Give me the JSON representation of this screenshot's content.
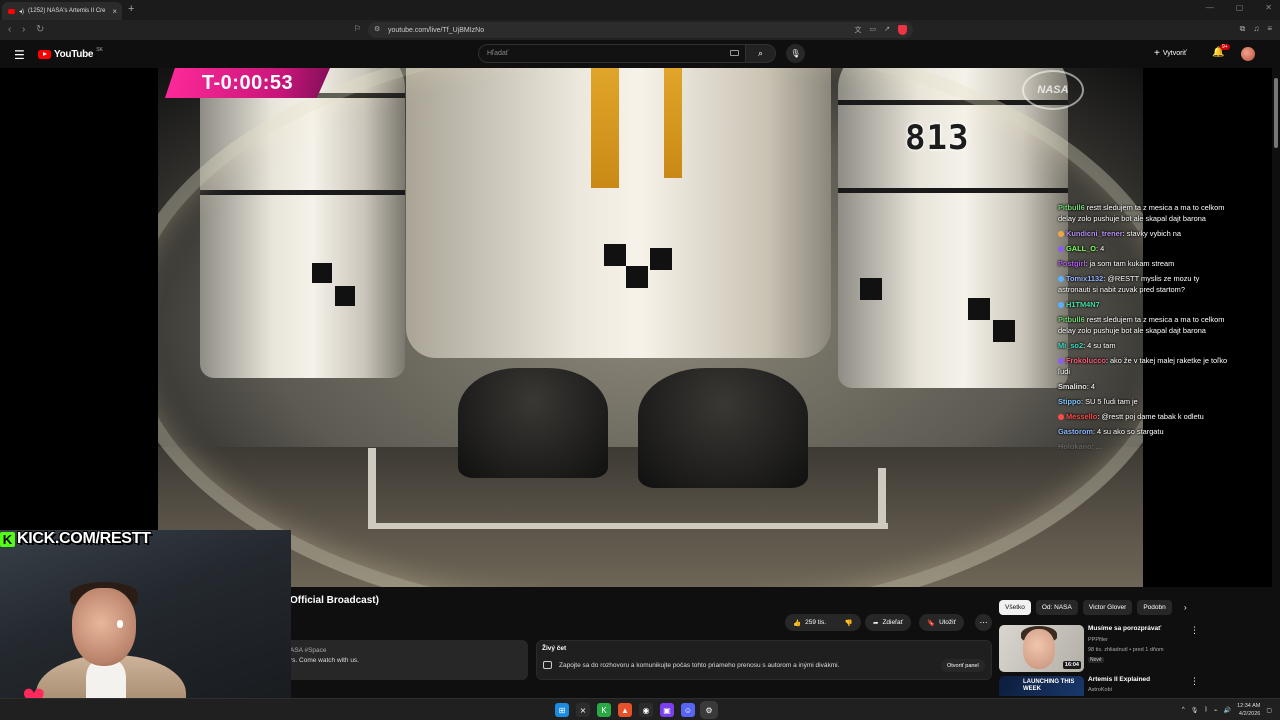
{
  "browser": {
    "tab_title": "(1252) NASA's Artemis II Cre",
    "url": "youtube.com/live/Tf_UjBMIzNo"
  },
  "masthead": {
    "logo_text": "YouTube",
    "country_code": "SK",
    "search_placeholder": "Hľadať",
    "create_label": "Vytvoriť",
    "notif_count": "9+"
  },
  "video": {
    "countdown": "T-0:00:53",
    "digits": "813",
    "logo_text": "NASA",
    "kick_channel": "KICK.COM/RESTT"
  },
  "chat": [
    {
      "name": "Pitbull6",
      "color": "#6fd46f",
      "text": " restt sledujem ta z mesica a ma to celkom delay zolo pushuje bot ale skapal dajt barona"
    },
    {
      "name": "Kundicni_trener",
      "color": "#b38cf0",
      "text": ": stavky vybich na",
      "badge": "#f0a640"
    },
    {
      "name": "GALL_O",
      "color": "#7cff5a",
      "text": ": 4",
      "badge": "#8a5cf5"
    },
    {
      "name": "Postgirl",
      "color": "#b05cf0",
      "text": ": ja som tam kukam stream"
    },
    {
      "name": "Tomix1132",
      "color": "#8fb2ff",
      "text": ": @RESTT myslis ze mozu ty astronauti si nabit zuvak pred startom?",
      "badge": "#5bb0ff"
    },
    {
      "name": "H1TM4N7",
      "color": "#45e0a8",
      "text": "",
      "badge": "#5bb0ff"
    },
    {
      "name": "Pitbull6",
      "color": "#6fd46f",
      "text": " restt sledujem ta z mesica a ma to celkom delay zolo pushuje bot ale skapal dajt barona"
    },
    {
      "name": "Mi_so2",
      "color": "#3ee0c6",
      "text": ": 4 su tam"
    },
    {
      "name": "Frokolucco",
      "color": "#ff5a7a",
      "text": ": ako že v takej malej raketke je toľko ľudi",
      "badge": "#8a5cf5"
    },
    {
      "name": "Smalino",
      "color": "#e6e6e6",
      "text": ": 4"
    },
    {
      "name": "Stippo",
      "color": "#7fc6ff",
      "text": ": SU 5 ľudi tam je"
    },
    {
      "name": "Messello",
      "color": "#ff4a4a",
      "text": ": @restt poj dame tabak k odletu",
      "badge": "#ff4a4a"
    },
    {
      "name": "Gastorom",
      "color": "#8ab8ff",
      "text": ": 4 su ako so stargatu"
    },
    {
      "name": "Holokano",
      "color": "#9a9a9a",
      "text": ": ..."
    }
  ],
  "below": {
    "title": "Official Broadcast)",
    "likes": "259 tis.",
    "share_label": "Zdieľať",
    "save_label": "Uložiť",
    "desc_tags": "ASA #Space",
    "desc_text": "rs. Come watch with us.",
    "live_chat_title": "Živý čet",
    "live_chat_text": "Zapojte sa do rozhovoru a komunikujte počas tohto priameho prenosu s autorom a inými divákmi.",
    "live_chat_button": "Otvoriť panel"
  },
  "chips": [
    "Všetko",
    "Od: NASA",
    "Victor Glover",
    "Podobn"
  ],
  "recommendations": [
    {
      "title": "Musíme sa porozprávať",
      "channel": "PPPfiler",
      "meta": "98 tis. zhliadnutí • pred 1 dňom",
      "badge": "Nové",
      "duration": "16:04"
    },
    {
      "title": "Artemis II Explained",
      "channel": "AstroKobi",
      "thumb_text": "LAUNCHING THIS WEEK"
    }
  ],
  "taskbar": {
    "time": "12:34 AM",
    "date": "4/2/2026"
  }
}
